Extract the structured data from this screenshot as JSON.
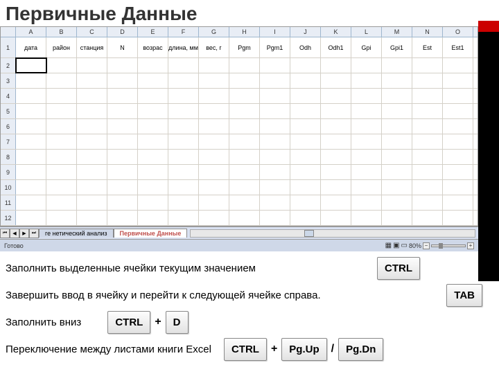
{
  "title": "Первичные Данные",
  "grid": {
    "columns": [
      "A",
      "B",
      "C",
      "D",
      "E",
      "F",
      "G",
      "H",
      "I",
      "J",
      "K",
      "L",
      "M",
      "N",
      "O"
    ],
    "headerRow": [
      "дата",
      "район",
      "станция",
      "N",
      "возрас",
      "длина, мм",
      "вес, г",
      "Pgm",
      "Pgm1",
      "Odh",
      "Odh1",
      "Gpi",
      "Gpi1",
      "Est",
      "Est1"
    ],
    "rowCount": 12,
    "selectedCell": {
      "row": 2,
      "col": 0
    }
  },
  "sheetTabs": {
    "nav": [
      "⏮",
      "◀",
      "▶",
      "⏭"
    ],
    "tabs": [
      {
        "label": "ге нетический анализ",
        "active": false
      },
      {
        "label": "Первичные Данные",
        "active": true
      }
    ]
  },
  "statusBar": {
    "ready": "Готово",
    "zoom": "80%"
  },
  "viewIcons": [
    "▦",
    "▣",
    "▭"
  ],
  "instructions": {
    "line1_text": "Заполнить выделенные ячейки текущим значением",
    "line1_key": "CTRL",
    "line2_text": "Завершить ввод в ячейку и перейти к следующей ячейке справа.",
    "line2_key": "TAB",
    "line3_text": "Заполнить вниз",
    "line3_key1": "CTRL",
    "line3_plus": "+",
    "line3_key2": "D",
    "line4_text": "Переключение между листами книги Excel",
    "line4_key1": "CTRL",
    "line4_plus": "+",
    "line4_key2": "Pg.Up",
    "line4_slash": "/",
    "line4_key3": "Pg.Dn"
  }
}
